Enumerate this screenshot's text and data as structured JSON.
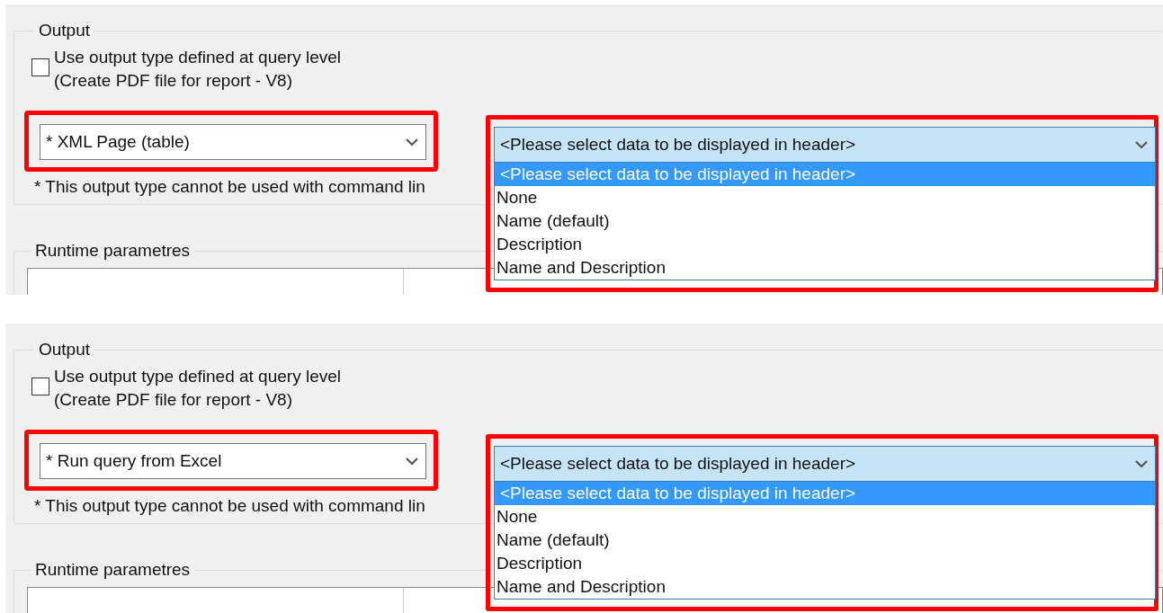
{
  "panels": [
    {
      "group_title": "Output",
      "checkbox": {
        "label_lines": [
          "Use output type defined at query level",
          "(Create PDF file for report - V8)"
        ],
        "checked": false
      },
      "output_type": {
        "value": "* XML Page (table)",
        "annotated": true
      },
      "note": "* This output type cannot be used with command lin",
      "header_combo": {
        "value": "<Please select data to be displayed in header>",
        "annotated": true,
        "expanded": true,
        "options": [
          {
            "label": "<Please select data to be displayed in header>",
            "selected": true
          },
          {
            "label": "None",
            "selected": false
          },
          {
            "label": "Name (default)",
            "selected": false
          },
          {
            "label": "Description",
            "selected": false
          },
          {
            "label": "Name and Description",
            "selected": false
          }
        ]
      },
      "runtime_group_title": "Runtime parametres"
    },
    {
      "group_title": "Output",
      "checkbox": {
        "label_lines": [
          "Use output type defined at query level",
          "(Create PDF file for report - V8)"
        ],
        "checked": false
      },
      "output_type": {
        "value": "* Run query from Excel",
        "annotated": true
      },
      "note": "* This output type cannot be used with command lin",
      "header_combo": {
        "value": "<Please select data to be displayed in header>",
        "annotated": true,
        "expanded": true,
        "options": [
          {
            "label": "<Please select data to be displayed in header>",
            "selected": true
          },
          {
            "label": "None",
            "selected": false
          },
          {
            "label": "Name (default)",
            "selected": false
          },
          {
            "label": "Description",
            "selected": false
          },
          {
            "label": "Name and Description",
            "selected": false
          }
        ]
      },
      "runtime_group_title": "Runtime parametres"
    }
  ]
}
